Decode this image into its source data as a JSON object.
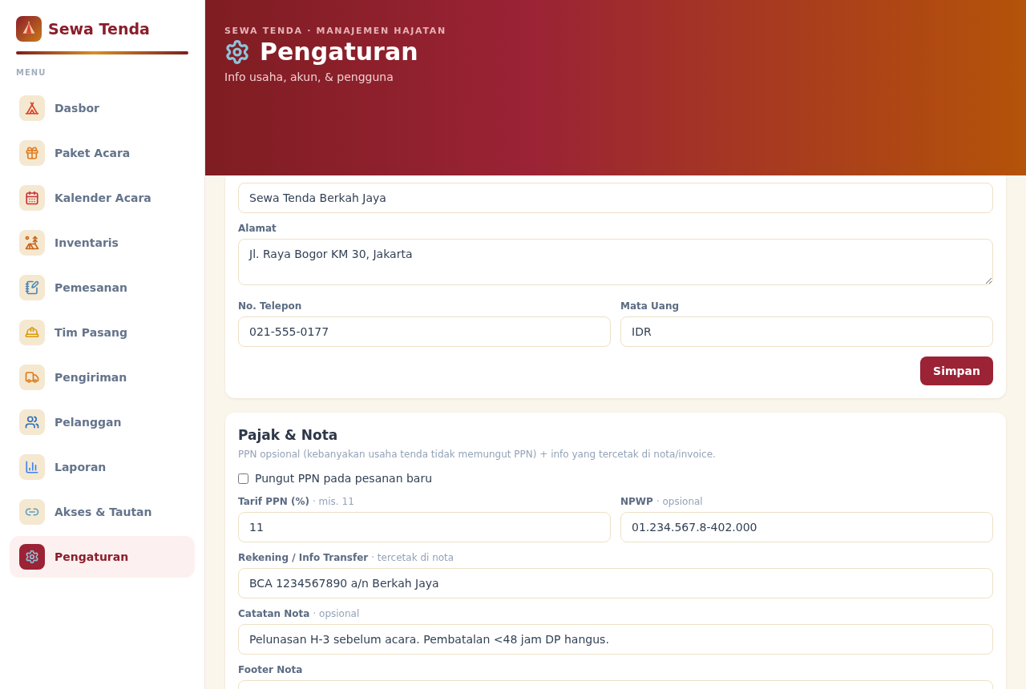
{
  "sidebar": {
    "brand": "Sewa Tenda",
    "section_label": "MENU",
    "items": [
      {
        "label": "Dasbor",
        "selected": false
      },
      {
        "label": "Paket Acara",
        "selected": false
      },
      {
        "label": "Kalender Acara",
        "selected": false
      },
      {
        "label": "Inventaris",
        "selected": false
      },
      {
        "label": "Pemesanan",
        "selected": false
      },
      {
        "label": "Tim Pasang",
        "selected": false
      },
      {
        "label": "Pengiriman",
        "selected": false
      },
      {
        "label": "Pelanggan",
        "selected": false
      },
      {
        "label": "Laporan",
        "selected": false
      },
      {
        "label": "Akses & Tautan",
        "selected": false
      },
      {
        "label": "Pengaturan",
        "selected": true
      }
    ]
  },
  "header": {
    "eyebrow": "SEWA TENDA · MANAJEMEN HAJATAN",
    "title": "Pengaturan",
    "subtitle": "Info usaha, akun, & pengguna"
  },
  "business_card": {
    "rows": [
      [
        {
          "kind": "input",
          "value": "Sewa Tenda Berkah Jaya"
        }
      ],
      [
        {
          "label": "Alamat",
          "kind": "textarea",
          "value": "Jl. Raya Bogor KM 30, Jakarta"
        }
      ],
      [
        {
          "label": "No. Telepon",
          "kind": "input",
          "value": "021-555-0177"
        },
        {
          "label": "Mata Uang",
          "kind": "input",
          "value": "IDR"
        }
      ]
    ],
    "save_button": "Simpan"
  },
  "tax_card": {
    "title": "Pajak & Nota",
    "description": "PPN opsional (kebanyakan usaha tenda tidak memungut PPN) + info yang tercetak di nota/invoice.",
    "checkbox": {
      "label": "Pungut PPN pada pesanan baru",
      "checked": false
    },
    "rows": [
      [
        {
          "label": "Tarif PPN (%)",
          "hint": "· mis. 11",
          "kind": "input",
          "value": "11"
        },
        {
          "label": "NPWP",
          "hint": "· opsional",
          "kind": "input",
          "value": "01.234.567.8-402.000"
        }
      ],
      [
        {
          "label": "Rekening / Info Transfer",
          "hint": "· tercetak di nota",
          "kind": "input",
          "value": "BCA 1234567890 a/n Berkah Jaya"
        }
      ],
      [
        {
          "label": "Catatan Nota",
          "hint": "· opsional",
          "kind": "input",
          "value": "Pelunasan H-3 sebelum acara. Pembatalan <48 jam DP hangus."
        }
      ],
      [
        {
          "label": "Footer Nota",
          "kind": "input"
        }
      ]
    ]
  }
}
